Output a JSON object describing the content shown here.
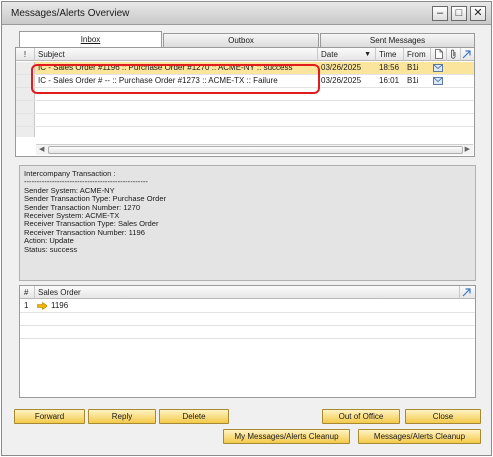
{
  "window": {
    "title": "Messages/Alerts Overview"
  },
  "tabs": [
    {
      "label": "Inbox",
      "active": true
    },
    {
      "label": "Outbox",
      "active": false
    },
    {
      "label": "Sent Messages",
      "active": false
    }
  ],
  "grid": {
    "headers": {
      "priority": "!",
      "subject": "Subject",
      "date": "Date",
      "time": "Time",
      "from": "From"
    },
    "rows": [
      {
        "subject": "IC - Sales Order #1196 :: Purchase Order #1270 :: ACME-NY :: success",
        "date": "03/26/2025",
        "time": "18:56",
        "from": "B1i"
      },
      {
        "subject": "IC - Sales Order # -- :: Purchase Order #1273 :: ACME-TX :: Failure",
        "date": "03/26/2025",
        "time": "16:01",
        "from": "B1i"
      }
    ]
  },
  "message_body": {
    "lines": [
      "Intercompany Transaction :",
      "-------------------------------------------------",
      "Sender System: ACME-NY",
      "Sender Transaction Type: Purchase Order",
      "Sender Transaction Number: 1270",
      "Receiver System: ACME-TX",
      "Receiver Transaction Type: Sales Order",
      "Receiver Transaction Number: 1196",
      "Action: Update",
      "Status: success"
    ]
  },
  "documents": {
    "headers": {
      "index": "#",
      "doc": "Sales Order"
    },
    "rows": [
      {
        "index": "1",
        "value": "1196"
      }
    ]
  },
  "buttons": {
    "forward": "Forward",
    "reply": "Reply",
    "delete": "Delete",
    "out_of_office": "Out of Office",
    "close": "Close",
    "my_cleanup": "My Messages/Alerts Cleanup",
    "cleanup": "Messages/Alerts Cleanup"
  },
  "colors": {
    "selected_row": "#fbe49b",
    "highlight_border": "#e21c1c",
    "button": "#f3c949",
    "link_icon": "#3a78c8",
    "arrow": "#f2b300"
  },
  "icons": [
    "minimize-icon",
    "maximize-icon",
    "close-icon",
    "sort-desc-icon",
    "attachment-icon",
    "document-icon",
    "expand-icon",
    "envelope-icon",
    "link-arrow-icon"
  ]
}
